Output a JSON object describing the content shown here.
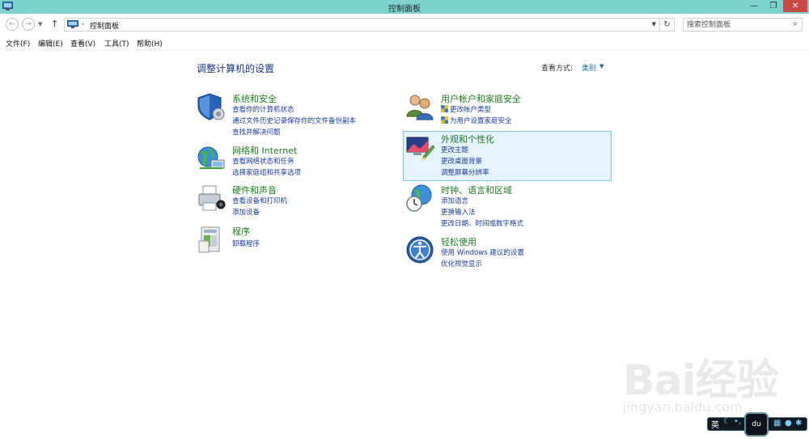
{
  "window": {
    "title": "控制面板",
    "min_symbol": "—",
    "max_symbol": "❐",
    "close_symbol": "✕"
  },
  "address": {
    "breadcrumb_sep": "›",
    "current": "控制面板",
    "search_placeholder": "搜索控制面板"
  },
  "menu": [
    "文件(F)",
    "编辑(E)",
    "查看(V)",
    "工具(T)",
    "帮助(H)"
  ],
  "main": {
    "title": "调整计算机的设置",
    "view_by_label": "查看方式:",
    "view_by_value": "类别"
  },
  "categories": [
    {
      "id": "system-security",
      "icon": "shield-icon",
      "title": "系统和安全",
      "links": [
        "查看你的计算机状态",
        "通过文件历史记录保存你的文件备份副本",
        "查找并解决问题"
      ]
    },
    {
      "id": "network-internet",
      "icon": "network-globe-icon",
      "title": "网络和 Internet",
      "links": [
        "查看网络状态和任务",
        "选择家庭组和共享选项"
      ]
    },
    {
      "id": "hardware-sound",
      "icon": "printer-icon",
      "title": "硬件和声音",
      "links": [
        "查看设备和打印机",
        "添加设备"
      ]
    },
    {
      "id": "programs",
      "icon": "programs-icon",
      "title": "程序",
      "links": [
        "卸载程序"
      ]
    },
    {
      "id": "user-accounts",
      "icon": "users-icon",
      "title": "用户帐户和家庭安全",
      "links": [
        "更改帐户类型",
        "为用户设置家庭安全"
      ]
    },
    {
      "id": "appearance",
      "icon": "appearance-icon",
      "title": "外观和个性化",
      "links": [
        "更改主题",
        "更改桌面背景",
        "调整屏幕分辨率"
      ]
    },
    {
      "id": "clock-region",
      "icon": "clock-globe-icon",
      "title": "时钟、语言和区域",
      "links": [
        "添加语言",
        "更换输入法",
        "更改日期、时间或数字格式"
      ]
    },
    {
      "id": "ease-of-access",
      "icon": "ease-of-access-icon",
      "title": "轻松使用",
      "links": [
        "使用 Windows 建议的设置",
        "优化视觉显示"
      ]
    }
  ],
  "watermark": {
    "brand": "Bai经验",
    "url": "jingyan.baidu.com"
  },
  "ime": {
    "lang": "英",
    "moon": "☾",
    "dot": "•,",
    "paw": "du"
  },
  "colors": {
    "titlebar": "#7ed3cf",
    "heading_green": "#1f7a1f",
    "link_blue": "#1b3a9f",
    "title_blue": "#1e3287",
    "hover_bg": "#e5f3fb"
  }
}
